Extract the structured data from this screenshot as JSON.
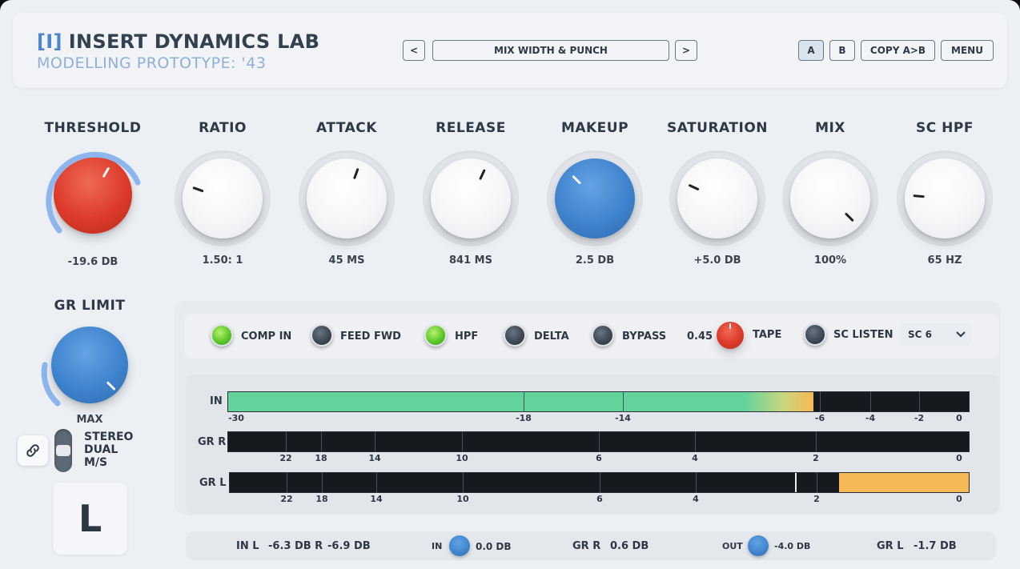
{
  "header": {
    "logo_mark": "[I]",
    "title": "INSERT DYNAMICS LAB",
    "subtitle": "MODELLING PROTOTYPE: '43",
    "prev_label": "<",
    "preset_name": "MIX WIDTH & PUNCH",
    "next_label": ">",
    "a_label": "A",
    "b_label": "B",
    "copy_label": "COPY A>B",
    "menu_label": "MENU"
  },
  "knobs": [
    {
      "title": "THRESHOLD",
      "value": "-19.6 DB",
      "color": "red",
      "angle": 30
    },
    {
      "title": "RATIO",
      "value": "1.50: 1",
      "color": "white",
      "angle": -70
    },
    {
      "title": "ATTACK",
      "value": "45 MS",
      "color": "white",
      "angle": 20
    },
    {
      "title": "RELEASE",
      "value": "841 MS",
      "color": "white",
      "angle": 25
    },
    {
      "title": "MAKEUP",
      "value": "2.5 DB",
      "color": "blue",
      "angle": -45
    },
    {
      "title": "SATURATION",
      "value": "+5.0 DB",
      "color": "white",
      "angle": -65
    },
    {
      "title": "MIX",
      "value": "100%",
      "color": "white",
      "angle": 135
    },
    {
      "title": "SC HPF",
      "value": "65 HZ",
      "color": "white",
      "angle": -85
    }
  ],
  "gr_limit": {
    "title": "GR LIMIT",
    "value": "MAX",
    "angle": 135
  },
  "modes": {
    "stereo": "STEREO",
    "dual": "DUAL",
    "ms": "M/S"
  },
  "channel": "L",
  "buttons": {
    "comp_in": "COMP IN",
    "feed_fwd": "FEED FWD",
    "hpf": "HPF",
    "delta": "DELTA",
    "bypass": "BYPASS",
    "tape_value": "0.45",
    "tape": "TAPE",
    "sc_listen": "SC LISTEN",
    "sc_select": "SC 6"
  },
  "meters": {
    "in_label": "IN",
    "grr_label": "GR R",
    "grl_label": "GR L",
    "in_ticks": [
      "-30",
      "-18",
      "-14",
      "-6",
      "-4",
      "-2",
      "0"
    ],
    "gr_ticks": [
      "22",
      "18",
      "14",
      "10",
      "6",
      "4",
      "2",
      "0"
    ],
    "in_level": 0.79,
    "grl_level": 0.175
  },
  "status": {
    "in_l": "IN L",
    "in_l_val": "-6.3 DB R",
    "in_r_val": "-6.9 DB",
    "in_knob_label": "IN",
    "in_knob_val": "0.0 DB",
    "gr_r": "GR R",
    "gr_r_val": "0.6 DB",
    "out_label": "OUT",
    "out_val": "-4.0 DB",
    "gr_l": "GR L",
    "gr_l_val": "-1.7 DB"
  },
  "colors": {
    "accent": "#3e83cd",
    "threshold": "#dc3a2a",
    "meter_green": "#62d39a",
    "meter_orange": "#f7b955"
  }
}
